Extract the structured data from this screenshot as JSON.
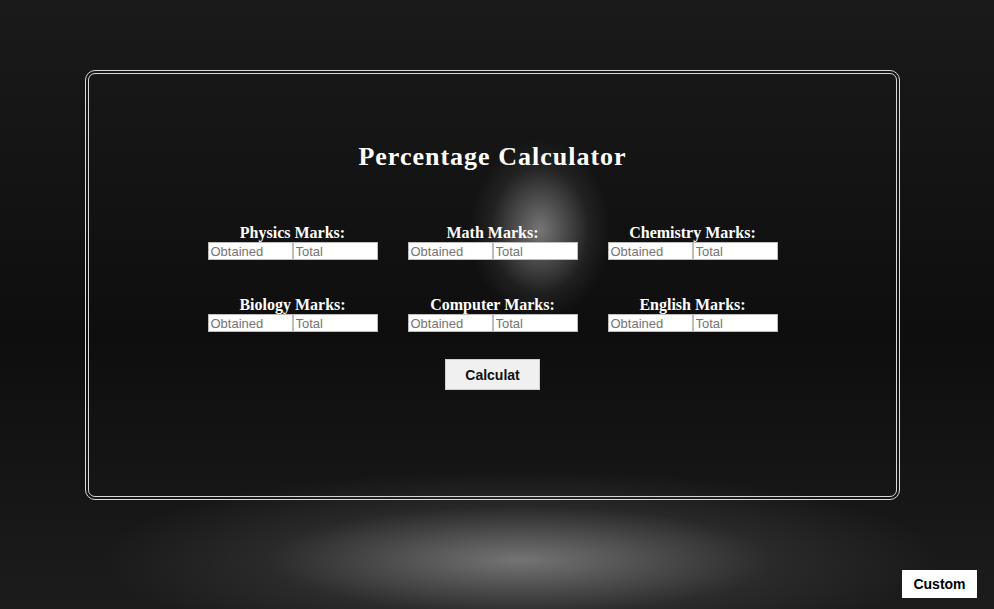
{
  "title": "Percentage Calculator",
  "subjects": [
    {
      "label": "Physics Marks:",
      "obtained_placeholder": "Obtained",
      "total_placeholder": "Total"
    },
    {
      "label": "Math Marks:",
      "obtained_placeholder": "Obtained",
      "total_placeholder": "Total"
    },
    {
      "label": "Chemistry Marks:",
      "obtained_placeholder": "Obtained",
      "total_placeholder": "Total"
    },
    {
      "label": "Biology Marks:",
      "obtained_placeholder": "Obtained",
      "total_placeholder": "Total"
    },
    {
      "label": "Computer Marks:",
      "obtained_placeholder": "Obtained",
      "total_placeholder": "Total"
    },
    {
      "label": "English Marks:",
      "obtained_placeholder": "Obtained",
      "total_placeholder": "Total"
    }
  ],
  "calculate_button": "Calculat",
  "custom_button": "Custom"
}
